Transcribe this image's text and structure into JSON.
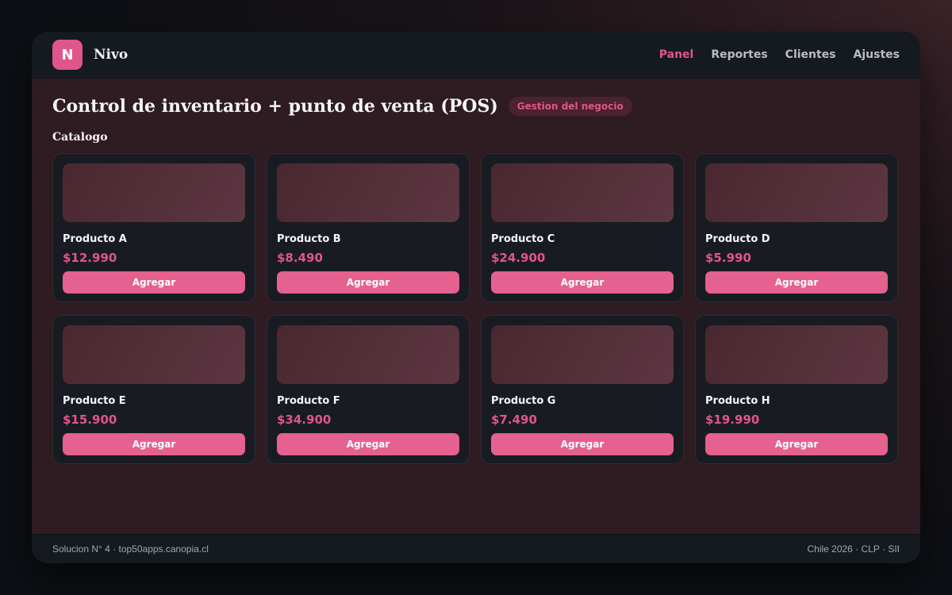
{
  "header": {
    "logo_letter": "N",
    "brand": "Nivo",
    "nav": [
      {
        "label": "Panel",
        "active": true
      },
      {
        "label": "Reportes",
        "active": false
      },
      {
        "label": "Clientes",
        "active": false
      },
      {
        "label": "Ajustes",
        "active": false
      }
    ]
  },
  "main": {
    "title": "Control de inventario + punto de venta (POS)",
    "badge": "Gestion del negocio",
    "section_title": "Catalogo",
    "products": [
      {
        "name": "Producto A",
        "price": "$12.990",
        "button": "Agregar"
      },
      {
        "name": "Producto B",
        "price": "$8.490",
        "button": "Agregar"
      },
      {
        "name": "Producto C",
        "price": "$24.900",
        "button": "Agregar"
      },
      {
        "name": "Producto D",
        "price": "$5.990",
        "button": "Agregar"
      },
      {
        "name": "Producto E",
        "price": "$15.900",
        "button": "Agregar"
      },
      {
        "name": "Producto F",
        "price": "$34.900",
        "button": "Agregar"
      },
      {
        "name": "Producto G",
        "price": "$7.490",
        "button": "Agregar"
      },
      {
        "name": "Producto H",
        "price": "$19.990",
        "button": "Agregar"
      }
    ]
  },
  "footer": {
    "left": "Solucion N° 4 · top50apps.canopia.cl",
    "right": "Chile 2026 · CLP · SII"
  },
  "colors": {
    "accent": "#e0558a",
    "button": "#e5618f",
    "card_bg": "#181b22",
    "bar_bg": "#151920",
    "content_bg": "#2f1c22"
  }
}
